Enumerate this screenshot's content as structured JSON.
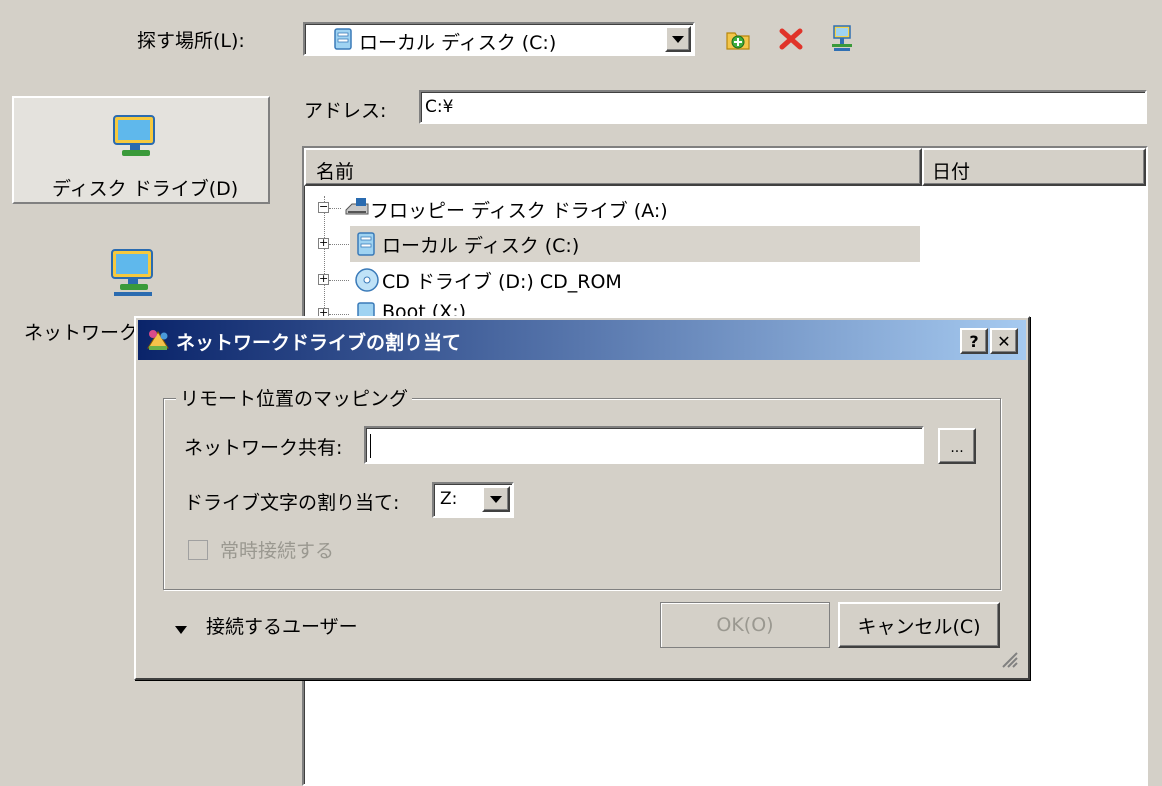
{
  "lookin": {
    "label": "探す場所(L):",
    "value": "ローカル ディスク (C:)"
  },
  "toolbar_icons": [
    "new-folder-icon",
    "delete-icon",
    "map-network-drive-icon"
  ],
  "address": {
    "label": "アドレス:",
    "value": "C:¥"
  },
  "places": [
    {
      "label": "ディスク ドライブ(D)",
      "icon": "computer-icon"
    },
    {
      "label": "ネットワーク上の位置(N)",
      "icon": "network-computer-icon"
    }
  ],
  "columns": [
    "名前",
    "日付"
  ],
  "tree": [
    {
      "label": "フロッピー ディスク ドライブ (A:)",
      "icon": "floppy-drive-icon",
      "expander": "−"
    },
    {
      "label": "ローカル ディスク (C:)",
      "icon": "local-disk-icon",
      "expander": "+",
      "selected": true
    },
    {
      "label": "CD ドライブ (D:) CD_ROM",
      "icon": "cd-drive-icon",
      "expander": "+"
    },
    {
      "label": "Boot (X:)",
      "icon": "disk-icon",
      "expander": "+"
    }
  ],
  "dialog": {
    "title": "ネットワークドライブの割り当て",
    "help_label": "?",
    "close_label": "✕",
    "group_label": "リモート位置のマッピング",
    "share_label": "ネットワーク共有:",
    "share_value": "",
    "browse_label": "...",
    "drive_label": "ドライブ文字の割り当て:",
    "drive_value": "Z:",
    "reconnect_label": "常時接続する",
    "connect_as_label": "接続するユーザー",
    "ok_label": "OK(O)",
    "cancel_label": "キャンセル(C)"
  }
}
